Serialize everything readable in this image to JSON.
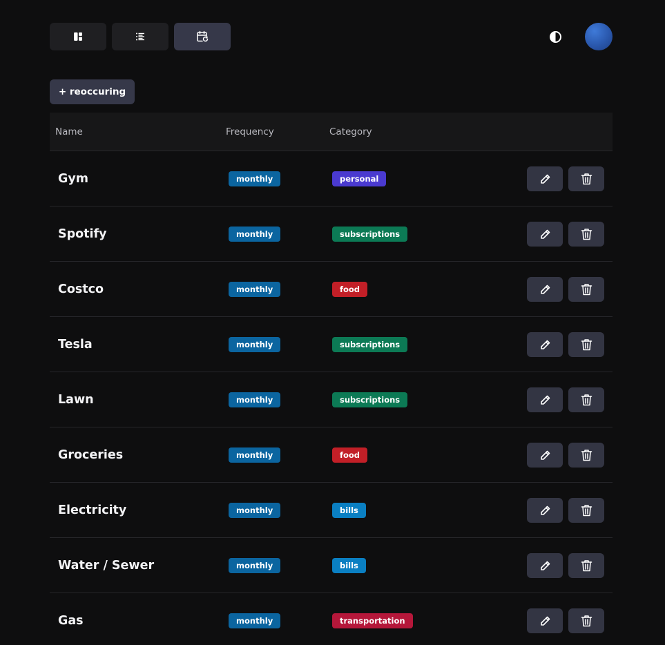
{
  "toolbar": {
    "views": [
      {
        "name": "dashboard-view-button",
        "icon": "dashboard-icon",
        "active": false
      },
      {
        "name": "list-view-button",
        "icon": "list-icon",
        "active": false
      },
      {
        "name": "recurring-view-button",
        "icon": "calendar-repeat-icon",
        "active": true
      }
    ],
    "theme_icon": "contrast-icon",
    "avatar_color": "#2a58ad"
  },
  "add_button_label": "+ reoccuring",
  "table": {
    "headers": {
      "name": "Name",
      "frequency": "Frequency",
      "category": "Category"
    },
    "rows": [
      {
        "name": "Gym",
        "frequency": "monthly",
        "category": "personal",
        "category_color": "#4a3ad0"
      },
      {
        "name": "Spotify",
        "frequency": "monthly",
        "category": "subscriptions",
        "category_color": "#0c7a55"
      },
      {
        "name": "Costco",
        "frequency": "monthly",
        "category": "food",
        "category_color": "#c21f27"
      },
      {
        "name": "Tesla",
        "frequency": "monthly",
        "category": "subscriptions",
        "category_color": "#0c7a55"
      },
      {
        "name": "Lawn",
        "frequency": "monthly",
        "category": "subscriptions",
        "category_color": "#0c7a55"
      },
      {
        "name": "Groceries",
        "frequency": "monthly",
        "category": "food",
        "category_color": "#c21f27"
      },
      {
        "name": "Electricity",
        "frequency": "monthly",
        "category": "bills",
        "category_color": "#0a7fc2"
      },
      {
        "name": "Water / Sewer",
        "frequency": "monthly",
        "category": "bills",
        "category_color": "#0a7fc2"
      },
      {
        "name": "Gas",
        "frequency": "monthly",
        "category": "transportation",
        "category_color": "#b5173a"
      }
    ]
  },
  "colors": {
    "background": "#0e0e0f",
    "frequency_badge": "#0b65a0",
    "button": "#333543"
  }
}
